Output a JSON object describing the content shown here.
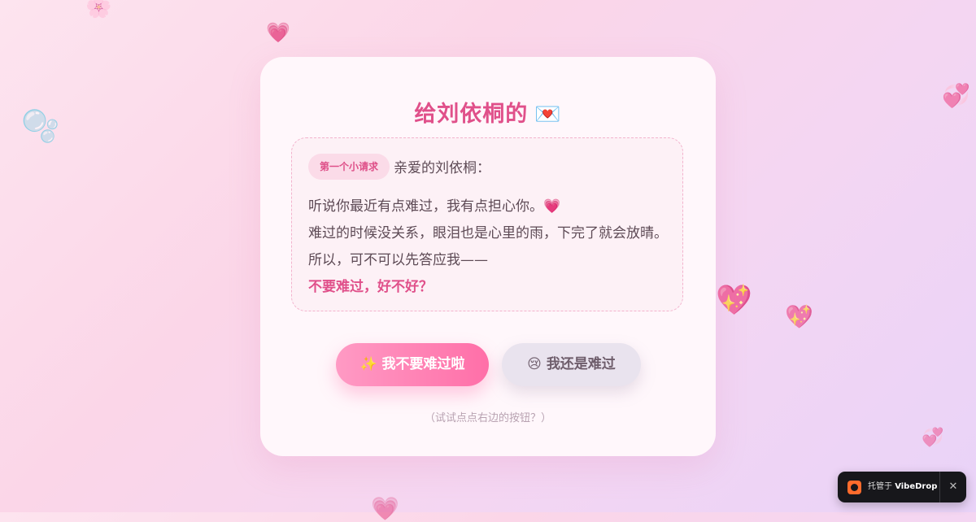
{
  "card": {
    "title": "给刘依桐的",
    "title_icon": "💌",
    "badge": "第一个小请求",
    "greeting": "亲爱的刘依桐：",
    "lines": [
      "听说你最近有点难过，我有点担心你。💗",
      "难过的时候没关系，眼泪也是心里的雨，下完了就会放晴。",
      "所以，可不可以先答应我——"
    ],
    "highlight": "不要难过，好不好？",
    "buttons": {
      "yes": "✨ 我不要难过啦",
      "no": "😢 我还是难过"
    },
    "hint": "（试试点点右边的按钮？）"
  },
  "decorations": [
    "🌸",
    "💗",
    "🫧",
    "💞",
    "💖",
    "💖",
    "💞",
    "💗"
  ],
  "toast": {
    "prefix": "托管于",
    "brand": "VibeDrop",
    "close": "✕"
  },
  "colors": {
    "accent": "#e0508a",
    "button_yes": "#ff7fb0",
    "button_no": "#e9e3ee",
    "background": "#fbd6e8"
  }
}
